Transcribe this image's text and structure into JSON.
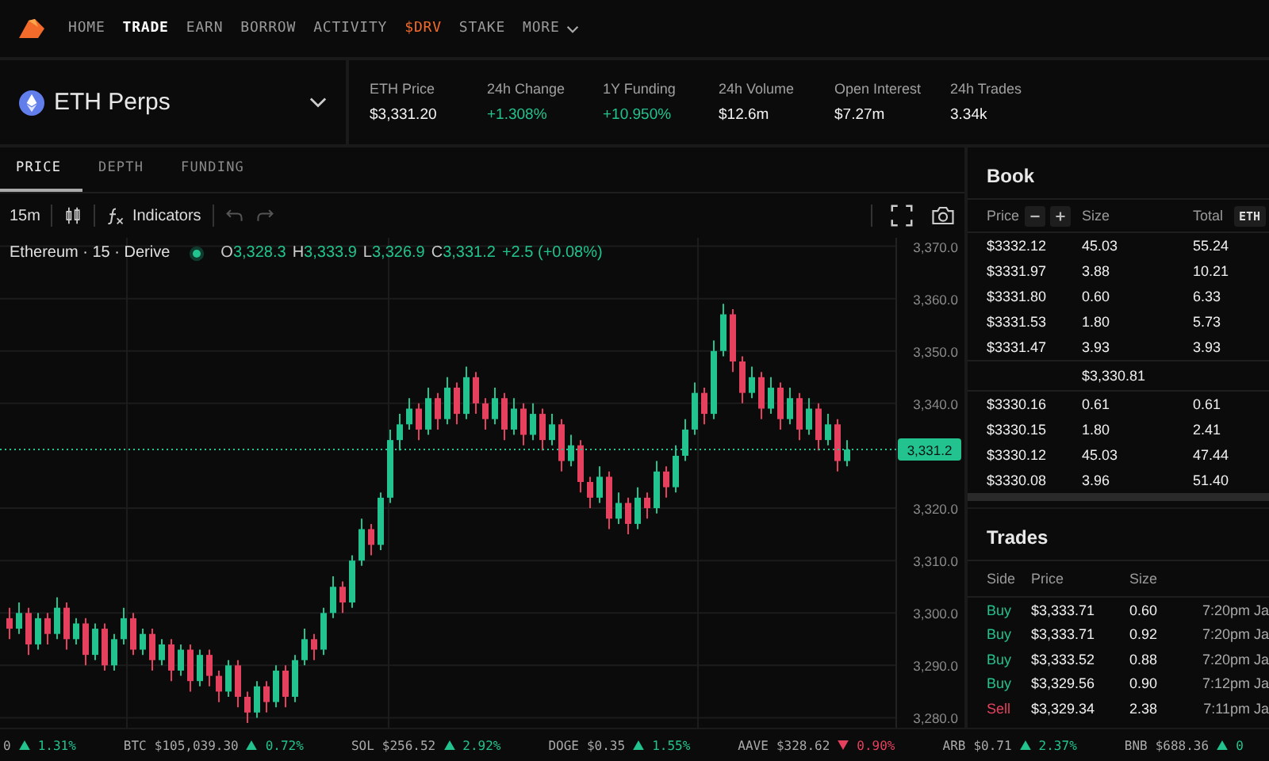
{
  "nav": {
    "items": [
      {
        "label": "HOME",
        "selected": false,
        "accent": false
      },
      {
        "label": "TRADE",
        "selected": true,
        "accent": false
      },
      {
        "label": "EARN",
        "selected": false,
        "accent": false
      },
      {
        "label": "BORROW",
        "selected": false,
        "accent": false
      },
      {
        "label": "ACTIVITY",
        "selected": false,
        "accent": false
      },
      {
        "label": "$DRV",
        "selected": false,
        "accent": true
      },
      {
        "label": "STAKE",
        "selected": false,
        "accent": false
      },
      {
        "label": "MORE",
        "selected": false,
        "accent": false
      }
    ]
  },
  "market": {
    "name": "ETH Perps"
  },
  "stats": [
    {
      "label": "ETH Price",
      "value": "$3,331.20",
      "positive": false
    },
    {
      "label": "24h Change",
      "value": "+1.308%",
      "positive": true
    },
    {
      "label": "1Y Funding",
      "value": "+10.950%",
      "positive": true
    },
    {
      "label": "24h Volume",
      "value": "$12.6m",
      "positive": false
    },
    {
      "label": "Open Interest",
      "value": "$7.27m",
      "positive": false
    },
    {
      "label": "24h Trades",
      "value": "3.34k",
      "positive": false
    }
  ],
  "tabs": [
    {
      "label": "PRICE",
      "selected": true
    },
    {
      "label": "DEPTH",
      "selected": false
    },
    {
      "label": "FUNDING",
      "selected": false
    }
  ],
  "toolbar": {
    "interval": "15m",
    "indicators": "Indicators"
  },
  "legend": {
    "title": "Ethereum · 15 · Derive",
    "ohlc": [
      {
        "key": "O",
        "value": "3,328.3"
      },
      {
        "key": "H",
        "value": "3,333.9"
      },
      {
        "key": "L",
        "value": "3,326.9"
      },
      {
        "key": "C",
        "value": "3,331.2"
      }
    ],
    "change": "+2.5 (+0.08%)"
  },
  "chart_data": {
    "type": "candlestick",
    "ylim": [
      3277.8,
      3371.6
    ],
    "grid": true,
    "ref_lines": [
      {
        "axis": "y",
        "value": 3331.2,
        "label": "3,331.2"
      }
    ],
    "yticks": [
      {
        "value": 3370,
        "label": "3,370.0"
      },
      {
        "value": 3360,
        "label": "3,360.0"
      },
      {
        "value": 3350,
        "label": "3,350.0"
      },
      {
        "value": 3340,
        "label": "3,340.0"
      },
      {
        "value": 3320,
        "label": "3,320.0"
      },
      {
        "value": 3310,
        "label": "3,310.0"
      },
      {
        "value": 3300,
        "label": "3,300.0"
      },
      {
        "value": 3290,
        "label": "3,290.0"
      },
      {
        "value": 3280,
        "label": "3,280.0"
      }
    ],
    "ohlc": [
      [
        3299,
        3301,
        3295,
        3297
      ],
      [
        3297,
        3302,
        3296,
        3300
      ],
      [
        3300,
        3301,
        3292,
        3294
      ],
      [
        3294,
        3300,
        3293,
        3299
      ],
      [
        3299,
        3300,
        3294,
        3296
      ],
      [
        3296,
        3303,
        3295,
        3301
      ],
      [
        3301,
        3302,
        3293,
        3295
      ],
      [
        3295,
        3299,
        3294,
        3298
      ],
      [
        3298,
        3299,
        3290,
        3292
      ],
      [
        3292,
        3298,
        3291,
        3297
      ],
      [
        3297,
        3298,
        3289,
        3290
      ],
      [
        3290,
        3296,
        3289,
        3295
      ],
      [
        3295,
        3301,
        3294,
        3299
      ],
      [
        3299,
        3300,
        3292,
        3293
      ],
      [
        3293,
        3297,
        3292,
        3296
      ],
      [
        3296,
        3297,
        3289,
        3291
      ],
      [
        3291,
        3295,
        3290,
        3294
      ],
      [
        3294,
        3295,
        3287,
        3289
      ],
      [
        3289,
        3294,
        3288,
        3293
      ],
      [
        3293,
        3294,
        3285,
        3287
      ],
      [
        3287,
        3293,
        3286,
        3292
      ],
      [
        3292,
        3293,
        3286,
        3288
      ],
      [
        3288,
        3289,
        3283,
        3285
      ],
      [
        3285,
        3291,
        3284,
        3290
      ],
      [
        3290,
        3291,
        3282,
        3284
      ],
      [
        3284,
        3285,
        3279,
        3281
      ],
      [
        3281,
        3287,
        3280,
        3286
      ],
      [
        3286,
        3287,
        3281,
        3283
      ],
      [
        3283,
        3290,
        3282,
        3289
      ],
      [
        3289,
        3290,
        3282,
        3284
      ],
      [
        3284,
        3292,
        3283,
        3291
      ],
      [
        3291,
        3297,
        3290,
        3295
      ],
      [
        3295,
        3296,
        3291,
        3293
      ],
      [
        3293,
        3301,
        3292,
        3300
      ],
      [
        3300,
        3307,
        3299,
        3305
      ],
      [
        3305,
        3306,
        3300,
        3302
      ],
      [
        3302,
        3311,
        3301,
        3310
      ],
      [
        3310,
        3318,
        3309,
        3316
      ],
      [
        3316,
        3317,
        3311,
        3313
      ],
      [
        3313,
        3323,
        3312,
        3322
      ],
      [
        3322,
        3335,
        3321,
        3333
      ],
      [
        3333,
        3338,
        3331,
        3336
      ],
      [
        3336,
        3341,
        3335,
        3339
      ],
      [
        3339,
        3340,
        3333,
        3335
      ],
      [
        3335,
        3343,
        3334,
        3341
      ],
      [
        3341,
        3342,
        3335,
        3337
      ],
      [
        3337,
        3345,
        3336,
        3343
      ],
      [
        3343,
        3344,
        3336,
        3338
      ],
      [
        3338,
        3347,
        3337,
        3345
      ],
      [
        3345,
        3346,
        3338,
        3340
      ],
      [
        3340,
        3341,
        3335,
        3337
      ],
      [
        3337,
        3343,
        3336,
        3341
      ],
      [
        3341,
        3342,
        3333,
        3335
      ],
      [
        3335,
        3341,
        3334,
        3339
      ],
      [
        3339,
        3340,
        3332,
        3334
      ],
      [
        3334,
        3340,
        3333,
        3338
      ],
      [
        3338,
        3339,
        3331,
        3333
      ],
      [
        3333,
        3338,
        3332,
        3336
      ],
      [
        3336,
        3337,
        3327,
        3329
      ],
      [
        3329,
        3334,
        3328,
        3332
      ],
      [
        3332,
        3333,
        3323,
        3325
      ],
      [
        3325,
        3326,
        3320,
        3322
      ],
      [
        3322,
        3328,
        3321,
        3326
      ],
      [
        3326,
        3327,
        3316,
        3318
      ],
      [
        3318,
        3323,
        3317,
        3321
      ],
      [
        3321,
        3322,
        3315,
        3317
      ],
      [
        3317,
        3324,
        3316,
        3322
      ],
      [
        3322,
        3323,
        3318,
        3320
      ],
      [
        3320,
        3329,
        3319,
        3327
      ],
      [
        3327,
        3328,
        3322,
        3324
      ],
      [
        3324,
        3332,
        3323,
        3330
      ],
      [
        3330,
        3337,
        3329,
        3335
      ],
      [
        3335,
        3344,
        3334,
        3342
      ],
      [
        3342,
        3343,
        3336,
        3338
      ],
      [
        3338,
        3352,
        3337,
        3350
      ],
      [
        3350,
        3359,
        3349,
        3357
      ],
      [
        3357,
        3358,
        3346,
        3348
      ],
      [
        3348,
        3349,
        3340,
        3342
      ],
      [
        3342,
        3347,
        3341,
        3345
      ],
      [
        3345,
        3346,
        3337,
        3339
      ],
      [
        3339,
        3345,
        3338,
        3343
      ],
      [
        3343,
        3344,
        3335,
        3337
      ],
      [
        3337,
        3343,
        3336,
        3341
      ],
      [
        3341,
        3342,
        3333,
        3335
      ],
      [
        3335,
        3341,
        3334,
        3339
      ],
      [
        3339,
        3340,
        3331,
        3333
      ],
      [
        3333,
        3338,
        3332,
        3336
      ],
      [
        3336,
        3337,
        3327,
        3329
      ],
      [
        3329,
        3333,
        3328,
        3331.2
      ]
    ]
  },
  "book": {
    "title": "Book",
    "columns": [
      "Price",
      "Size",
      "Total"
    ],
    "unit": "ETH",
    "asks": [
      {
        "price": "$3332.12",
        "size": "45.03",
        "total": "55.24"
      },
      {
        "price": "$3331.97",
        "size": "3.88",
        "total": "10.21"
      },
      {
        "price": "$3331.80",
        "size": "0.60",
        "total": "6.33"
      },
      {
        "price": "$3331.53",
        "size": "1.80",
        "total": "5.73"
      },
      {
        "price": "$3331.47",
        "size": "3.93",
        "total": "3.93"
      }
    ],
    "mid": "$3,330.81",
    "bids": [
      {
        "price": "$3330.16",
        "size": "0.61",
        "total": "0.61"
      },
      {
        "price": "$3330.15",
        "size": "1.80",
        "total": "2.41"
      },
      {
        "price": "$3330.12",
        "size": "45.03",
        "total": "47.44"
      },
      {
        "price": "$3330.08",
        "size": "3.96",
        "total": "51.40"
      }
    ]
  },
  "trades": {
    "title": "Trades",
    "columns": [
      "Side",
      "Price",
      "Size"
    ],
    "rows": [
      {
        "side": "Buy",
        "kind": "buy",
        "price": "$3,333.71",
        "size": "0.60",
        "time": "7:20pm Ja"
      },
      {
        "side": "Buy",
        "kind": "buy",
        "price": "$3,333.71",
        "size": "0.92",
        "time": "7:20pm Ja"
      },
      {
        "side": "Buy",
        "kind": "buy",
        "price": "$3,333.52",
        "size": "0.88",
        "time": "7:20pm Ja"
      },
      {
        "side": "Buy",
        "kind": "buy",
        "price": "$3,329.56",
        "size": "0.90",
        "time": "7:12pm Ja"
      },
      {
        "side": "Sell",
        "kind": "sell",
        "price": "$3,329.34",
        "size": "2.38",
        "time": "7:11pm Ja"
      }
    ]
  },
  "ticker": [
    {
      "price": "0",
      "change": "1.31%",
      "up": true
    },
    {
      "symbol": "BTC",
      "price": "$105,039.30",
      "change": "0.72%",
      "up": true
    },
    {
      "symbol": "SOL",
      "price": "$256.52",
      "change": "2.92%",
      "up": true
    },
    {
      "symbol": "DOGE",
      "price": "$0.35",
      "change": "1.55%",
      "up": true
    },
    {
      "symbol": "AAVE",
      "price": "$328.62",
      "change": "0.90%",
      "up": false
    },
    {
      "symbol": "ARB",
      "price": "$0.71",
      "change": "2.37%",
      "up": true
    },
    {
      "symbol": "BNB",
      "price": "$688.36",
      "change": "0",
      "up": true
    }
  ]
}
